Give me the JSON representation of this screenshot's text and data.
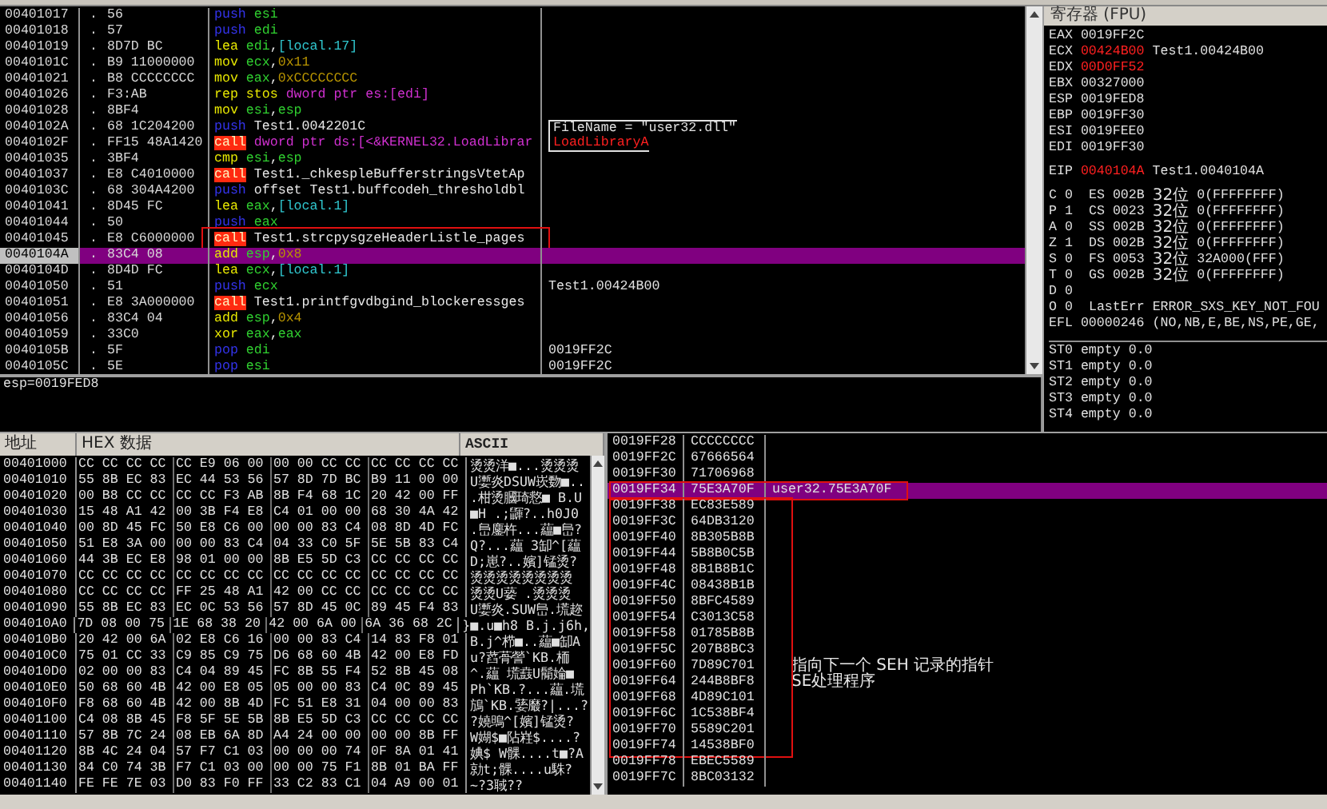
{
  "disassembly": {
    "rows": [
      {
        "address": "00401017",
        "marker": ".",
        "bytes": "56",
        "tokens": [
          {
            "text": "push",
            "kind": "stackop"
          },
          {
            "text": "esi",
            "kind": "reg"
          }
        ],
        "selected": false,
        "boxed": false
      },
      {
        "address": "00401018",
        "marker": ".",
        "bytes": "57",
        "tokens": [
          {
            "text": "push",
            "kind": "stackop"
          },
          {
            "text": "edi",
            "kind": "reg"
          }
        ],
        "selected": false,
        "boxed": false
      },
      {
        "address": "00401019",
        "marker": ".",
        "bytes": "8D7D BC",
        "tokens": [
          {
            "text": "lea",
            "kind": "op"
          },
          {
            "text": "edi",
            "kind": "reg"
          },
          {
            "text": ",",
            "kind": "plain"
          },
          {
            "text": "[local.17]",
            "kind": "mem"
          }
        ],
        "selected": false,
        "boxed": false
      },
      {
        "address": "0040101C",
        "marker": ".",
        "bytes": "B9 11000000",
        "tokens": [
          {
            "text": "mov",
            "kind": "op"
          },
          {
            "text": "ecx",
            "kind": "reg"
          },
          {
            "text": ",",
            "kind": "plain"
          },
          {
            "text": "0x11",
            "kind": "const"
          }
        ],
        "selected": false,
        "boxed": false
      },
      {
        "address": "00401021",
        "marker": ".",
        "bytes": "B8 CCCCCCCC",
        "tokens": [
          {
            "text": "mov",
            "kind": "op"
          },
          {
            "text": "eax",
            "kind": "reg"
          },
          {
            "text": ",",
            "kind": "plain"
          },
          {
            "text": "0xCCCCCCCC",
            "kind": "const"
          }
        ],
        "selected": false,
        "boxed": false
      },
      {
        "address": "00401026",
        "marker": ".",
        "bytes": "F3:AB",
        "tokens": [
          {
            "text": "rep stos",
            "kind": "op"
          },
          {
            "text": "dword ptr es:[edi]",
            "kind": "ptr"
          }
        ],
        "selected": false,
        "boxed": false
      },
      {
        "address": "00401028",
        "marker": ".",
        "bytes": "8BF4",
        "tokens": [
          {
            "text": "mov",
            "kind": "op"
          },
          {
            "text": "esi",
            "kind": "reg"
          },
          {
            "text": ",",
            "kind": "plain"
          },
          {
            "text": "esp",
            "kind": "reg"
          }
        ],
        "selected": false,
        "boxed": false
      },
      {
        "address": "0040102A",
        "marker": ".",
        "bytes": "68 1C204200",
        "tokens": [
          {
            "text": "push",
            "kind": "stackop"
          },
          {
            "text": "Test1.0042201C",
            "kind": "sym"
          }
        ],
        "comment": {
          "text": "FileName = \"user32.dll\"",
          "kind": "arg"
        },
        "selected": false,
        "boxed": false
      },
      {
        "address": "0040102F",
        "marker": ".",
        "bytes": "FF15 48A1420",
        "tokens": [
          {
            "text": "call",
            "kind": "callop"
          },
          {
            "text": "dword ptr ds:[<&KERNEL32.LoadLibrar",
            "kind": "ptr"
          }
        ],
        "comment": {
          "text": "LoadLibraryA",
          "kind": "api"
        },
        "selected": false,
        "boxed": false
      },
      {
        "address": "00401035",
        "marker": ".",
        "bytes": "3BF4",
        "tokens": [
          {
            "text": "cmp",
            "kind": "op"
          },
          {
            "text": "esi",
            "kind": "reg"
          },
          {
            "text": ",",
            "kind": "plain"
          },
          {
            "text": "esp",
            "kind": "reg"
          }
        ],
        "selected": false,
        "boxed": false
      },
      {
        "address": "00401037",
        "marker": ".",
        "bytes": "E8 C4010000",
        "tokens": [
          {
            "text": "call",
            "kind": "callop"
          },
          {
            "text": "Test1._chkespleBufferstringsVtetAp",
            "kind": "sym"
          }
        ],
        "selected": false,
        "boxed": false
      },
      {
        "address": "0040103C",
        "marker": ".",
        "bytes": "68 304A4200",
        "tokens": [
          {
            "text": "push",
            "kind": "stackop"
          },
          {
            "text": "offset Test1.buffcodeh_thresholdbl",
            "kind": "sym"
          }
        ],
        "selected": false,
        "boxed": false
      },
      {
        "address": "00401041",
        "marker": ".",
        "bytes": "8D45 FC",
        "tokens": [
          {
            "text": "lea",
            "kind": "op"
          },
          {
            "text": "eax",
            "kind": "reg"
          },
          {
            "text": ",",
            "kind": "plain"
          },
          {
            "text": "[local.1]",
            "kind": "mem"
          }
        ],
        "selected": false,
        "boxed": false
      },
      {
        "address": "00401044",
        "marker": ".",
        "bytes": "50",
        "tokens": [
          {
            "text": "push",
            "kind": "stackop"
          },
          {
            "text": "eax",
            "kind": "reg"
          }
        ],
        "selected": false,
        "boxed": false
      },
      {
        "address": "00401045",
        "marker": ".",
        "bytes": "E8 C6000000",
        "tokens": [
          {
            "text": "call",
            "kind": "callop"
          },
          {
            "text": "Test1.strcpysgzeHeaderListle_pages",
            "kind": "sym"
          }
        ],
        "selected": false,
        "boxed": true
      },
      {
        "address": "0040104A",
        "marker": ".",
        "bytes": "83C4 08",
        "tokens": [
          {
            "text": "add",
            "kind": "op"
          },
          {
            "text": "esp",
            "kind": "reg"
          },
          {
            "text": ",",
            "kind": "plain"
          },
          {
            "text": "0x8",
            "kind": "const"
          }
        ],
        "selected": true,
        "boxed": false
      },
      {
        "address": "0040104D",
        "marker": ".",
        "bytes": "8D4D FC",
        "tokens": [
          {
            "text": "lea",
            "kind": "op"
          },
          {
            "text": "ecx",
            "kind": "reg"
          },
          {
            "text": ",",
            "kind": "plain"
          },
          {
            "text": "[local.1]",
            "kind": "mem"
          }
        ],
        "selected": false,
        "boxed": false
      },
      {
        "address": "00401050",
        "marker": ".",
        "bytes": "51",
        "tokens": [
          {
            "text": "push",
            "kind": "stackop"
          },
          {
            "text": "ecx",
            "kind": "reg"
          }
        ],
        "comment": {
          "text": "Test1.00424B00",
          "kind": "plain"
        },
        "selected": false,
        "boxed": false
      },
      {
        "address": "00401051",
        "marker": ".",
        "bytes": "E8 3A000000",
        "tokens": [
          {
            "text": "call",
            "kind": "callop"
          },
          {
            "text": "Test1.printfgvdbgind_blockeressges",
            "kind": "sym"
          }
        ],
        "selected": false,
        "boxed": false
      },
      {
        "address": "00401056",
        "marker": ".",
        "bytes": "83C4 04",
        "tokens": [
          {
            "text": "add",
            "kind": "op"
          },
          {
            "text": "esp",
            "kind": "reg"
          },
          {
            "text": ",",
            "kind": "plain"
          },
          {
            "text": "0x4",
            "kind": "const"
          }
        ],
        "selected": false,
        "boxed": false
      },
      {
        "address": "00401059",
        "marker": ".",
        "bytes": "33C0",
        "tokens": [
          {
            "text": "xor",
            "kind": "op"
          },
          {
            "text": "eax",
            "kind": "reg"
          },
          {
            "text": ",",
            "kind": "plain"
          },
          {
            "text": "eax",
            "kind": "reg"
          }
        ],
        "selected": false,
        "boxed": false
      },
      {
        "address": "0040105B",
        "marker": ".",
        "bytes": "5F",
        "tokens": [
          {
            "text": "pop",
            "kind": "stackop"
          },
          {
            "text": "edi",
            "kind": "reg"
          }
        ],
        "comment": {
          "text": "0019FF2C",
          "kind": "plain"
        },
        "selected": false,
        "boxed": false
      },
      {
        "address": "0040105C",
        "marker": ".",
        "bytes": "5E",
        "tokens": [
          {
            "text": "pop",
            "kind": "stackop"
          },
          {
            "text": "esi",
            "kind": "reg"
          }
        ],
        "comment": {
          "text": "0019FF2C",
          "kind": "plain"
        },
        "selected": false,
        "boxed": false
      }
    ]
  },
  "info_line": "esp=0019FED8",
  "registers": {
    "title": "寄存器 (FPU)",
    "general": [
      {
        "name": "EAX",
        "value": "0019FF2C",
        "changed": false
      },
      {
        "name": "ECX",
        "value": "00424B00",
        "changed": true,
        "comment": "Test1.00424B00"
      },
      {
        "name": "EDX",
        "value": "00D0FF52",
        "changed": true
      },
      {
        "name": "EBX",
        "value": "00327000",
        "changed": false
      },
      {
        "name": "ESP",
        "value": "0019FED8",
        "changed": false
      },
      {
        "name": "EBP",
        "value": "0019FF30",
        "changed": false
      },
      {
        "name": "ESI",
        "value": "0019FEE0",
        "changed": false
      },
      {
        "name": "EDI",
        "value": "0019FF30",
        "changed": false
      }
    ],
    "eip": {
      "name": "EIP",
      "value": "0040104A",
      "changed": true,
      "comment": "Test1.0040104A"
    },
    "flags": [
      {
        "flag": "C",
        "value": "0",
        "segment": "ES",
        "selector": "002B",
        "bits": "32位",
        "limit": "0(FFFFFFFF)"
      },
      {
        "flag": "P",
        "value": "1",
        "segment": "CS",
        "selector": "0023",
        "bits": "32位",
        "limit": "0(FFFFFFFF)"
      },
      {
        "flag": "A",
        "value": "0",
        "segment": "SS",
        "selector": "002B",
        "bits": "32位",
        "limit": "0(FFFFFFFF)"
      },
      {
        "flag": "Z",
        "value": "1",
        "segment": "DS",
        "selector": "002B",
        "bits": "32位",
        "limit": "0(FFFFFFFF)"
      },
      {
        "flag": "S",
        "value": "0",
        "segment": "FS",
        "selector": "0053",
        "bits": "32位",
        "limit": "32A000(FFF)"
      },
      {
        "flag": "T",
        "value": "0",
        "segment": "GS",
        "selector": "002B",
        "bits": "32位",
        "limit": "0(FFFFFFFF)"
      },
      {
        "flag": "D",
        "value": "0"
      },
      {
        "flag": "O",
        "value": "0",
        "last_error_label": "LastErr",
        "last_error": "ERROR_SXS_KEY_NOT_FOU"
      }
    ],
    "efl": {
      "name": "EFL",
      "value": "00000246",
      "comment": "(NO,NB,E,BE,NS,PE,GE,"
    },
    "fpu": [
      {
        "name": "ST0",
        "tag": "empty",
        "value": "0.0"
      },
      {
        "name": "ST1",
        "tag": "empty",
        "value": "0.0"
      },
      {
        "name": "ST2",
        "tag": "empty",
        "value": "0.0"
      },
      {
        "name": "ST3",
        "tag": "empty",
        "value": "0.0"
      },
      {
        "name": "ST4",
        "tag": "empty",
        "value": "0.0"
      }
    ]
  },
  "dump": {
    "headers": [
      "地址",
      "HEX 数据",
      "ASCII"
    ],
    "rows": [
      {
        "address": "00401000",
        "hex": [
          "CC CC CC CC",
          "CC E9 06 00",
          "00 00 CC CC",
          "CC CC CC CC"
        ],
        "ascii": "烫烫洋■...烫烫烫"
      },
      {
        "address": "00401010",
        "hex": [
          "55 8B EC 83",
          "EC 44 53 56",
          "57 8D 7D BC",
          "B9 11 00 00"
        ],
        "ascii": "U嬱炎DSUW崁覅■.."
      },
      {
        "address": "00401020",
        "hex": [
          "00 B8 CC CC",
          "CC CC F3 AB",
          "8B F4 68 1C",
          "20 42 00 FF"
        ],
        "ascii": ".柑烫膕琦慦■ B.U"
      },
      {
        "address": "00401030",
        "hex": [
          "15 48 A1 42",
          "00 3B F4 E8",
          "C4 01 00 00",
          "68 30 4A 42"
        ],
        "ascii": "■H .;鼲?..h0J0"
      },
      {
        "address": "00401040",
        "hex": [
          "00 8D 45 FC",
          "50 E8 C6 00",
          "00 00 83 C4",
          "08 8D 4D FC"
        ],
        "ascii": ".峊鏖杵...藴■峊?"
      },
      {
        "address": "00401050",
        "hex": [
          "51 E8 3A 00",
          "00 00 83 C4",
          "04 33 C0 5F",
          "5E 5B 83 C4"
        ],
        "ascii": "Q?...藴 3缷^[藴"
      },
      {
        "address": "00401060",
        "hex": [
          "44 3B EC E8",
          "98 01 00 00",
          "8B E5 5D C3",
          "CC CC CC CC"
        ],
        "ascii": "D;崽?..嬪]锰烫?"
      },
      {
        "address": "00401070",
        "hex": [
          "CC CC CC CC",
          "CC CC CC CC",
          "CC CC CC CC",
          "CC CC CC CC"
        ],
        "ascii": "烫烫烫烫烫烫烫烫"
      },
      {
        "address": "00401080",
        "hex": [
          "CC CC CC CC",
          "FF 25 48 A1",
          "42 00 CC CC",
          "CC CC CC CC"
        ],
        "ascii": "烫烫U蒆 .烫烫烫"
      },
      {
        "address": "00401090",
        "hex": [
          "55 8B EC 83",
          "EC 0C 53 56",
          "57 8D 45 0C",
          "89 45 F4 83"
        ],
        "ascii": "U嬱炎.SUW峊.塃趂"
      },
      {
        "address": "004010A0",
        "hex": [
          "7D 08 00 75",
          "1E 68 38 20",
          "42 00 6A 00",
          "6A 36 68 2C"
        ],
        "ascii": "}■.u■h8 B.j.j6h,"
      },
      {
        "address": "004010B0",
        "hex": [
          "20 42 00 6A",
          "02 E8 C6 16",
          "00 00 83 C4",
          "14 83 F8 01"
        ],
        "ascii": " B.j^栉■..藴■缷A"
      },
      {
        "address": "004010C0",
        "hex": [
          "75 01 CC 33",
          "C9 85 C9 75",
          "D6 68 60 4B",
          "42 00 E8 FD"
        ],
        "ascii": "u?蓞蓇謍`KB.栭"
      },
      {
        "address": "004010D0",
        "hex": [
          "02 00 00 83",
          "C4 04 89 45",
          "FC 8B 55 F4",
          "52 8B 45 08"
        ],
        "ascii": "^.藴 塃鼖U鬜婨■"
      },
      {
        "address": "004010E0",
        "hex": [
          "50 68 60 4B",
          "42 00 E8 05",
          "05 00 00 83",
          "C4 0C 89 45"
        ],
        "ascii": "Ph`KB.?...藴.塃"
      },
      {
        "address": "004010F0",
        "hex": [
          "F8 68 60 4B",
          "42 00 8B 4D",
          "FC 51 E8 31",
          "04 00 00 83"
        ],
        "ascii": "鴋`KB.婱黀?|...?"
      },
      {
        "address": "00401100",
        "hex": [
          "C4 08 8B 45",
          "F8 5F 5E 5B",
          "8B E5 5D C3",
          "CC CC CC CC"
        ],
        "ascii": "?嬈鴠^[嬪]锰烫?"
      },
      {
        "address": "00401110",
        "hex": [
          "57 8B 7C 24",
          "08 EB 6A 8D",
          "A4 24 00 00",
          "00 00 8B FF"
        ],
        "ascii": "W媩$■阽嵀$....?"
      },
      {
        "address": "00401120",
        "hex": [
          "8B 4C 24 04",
          "57 F7 C1 03",
          "00 00 00 74",
          "0F 8A 01 41"
        ],
        "ascii": "婰$ W髁....t■?A"
      },
      {
        "address": "00401130",
        "hex": [
          "84 C0 74 3B",
          "F7 C1 03 00",
          "00 00 75 F1",
          "8B 01 BA FF"
        ],
        "ascii": "勍t;髁....u駯?"
      },
      {
        "address": "00401140",
        "hex": [
          "FE FE 7E 03",
          "D0 83 F0 FF",
          "33 C2 83 C1",
          "04 A9 00 01"
        ],
        "ascii": "~?3聝??"
      }
    ]
  },
  "stack": {
    "groups": [
      {
        "boxed": false,
        "rows": [
          {
            "address": "0019FF28",
            "value": "CCCCCCCC",
            "selected": false,
            "outlined": false
          },
          {
            "address": "0019FF2C",
            "value": "67666564",
            "selected": false,
            "outlined": false
          },
          {
            "address": "0019FF30",
            "value": "71706968",
            "selected": false,
            "outlined": false
          },
          {
            "address": "0019FF34",
            "value": "75E3A70F",
            "comment": {
              "text": "user32.75E3A70F",
              "kind": "plain"
            },
            "selected": true,
            "outlined": true
          }
        ]
      },
      {
        "boxed": true,
        "rows": [
          {
            "address": "0019FF38",
            "value": "EC83E589",
            "selected": false,
            "outlined": false
          },
          {
            "address": "0019FF3C",
            "value": "64DB3120",
            "selected": false,
            "outlined": false
          },
          {
            "address": "0019FF40",
            "value": "8B305B8B",
            "selected": false,
            "outlined": false
          },
          {
            "address": "0019FF44",
            "value": "5B8B0C5B",
            "selected": false,
            "outlined": false
          },
          {
            "address": "0019FF48",
            "value": "8B1B8B1C",
            "selected": false,
            "outlined": false
          },
          {
            "address": "0019FF4C",
            "value": "08438B1B",
            "selected": false,
            "outlined": false
          },
          {
            "address": "0019FF50",
            "value": "8BFC4589",
            "selected": false,
            "outlined": false
          },
          {
            "address": "0019FF54",
            "value": "C3013C58",
            "selected": false,
            "outlined": false
          },
          {
            "address": "0019FF58",
            "value": "01785B8B",
            "selected": false,
            "outlined": false
          },
          {
            "address": "0019FF5C",
            "value": "207B8BC3",
            "selected": false,
            "outlined": false
          },
          {
            "address": "0019FF60",
            "value": "7D89C701",
            "comment": {
              "text": "指向下一个 SEH 记录的指针",
              "kind": "note"
            },
            "selected": false,
            "outlined": false
          },
          {
            "address": "0019FF64",
            "value": "244B8BF8",
            "comment": {
              "text": "SE处理程序",
              "kind": "note"
            },
            "selected": false,
            "outlined": false
          },
          {
            "address": "0019FF68",
            "value": "4D89C101",
            "selected": false,
            "outlined": false
          },
          {
            "address": "0019FF6C",
            "value": "1C538BF4",
            "selected": false,
            "outlined": false
          },
          {
            "address": "0019FF70",
            "value": "5589C201",
            "selected": false,
            "outlined": false
          },
          {
            "address": "0019FF74",
            "value": "14538BF0",
            "selected": false,
            "outlined": false
          }
        ]
      },
      {
        "boxed": false,
        "rows": [
          {
            "address": "0019FF78",
            "value": "EBEC5589",
            "selected": false,
            "outlined": false
          },
          {
            "address": "0019FF7C",
            "value": "8BC03132",
            "selected": false,
            "outlined": false
          }
        ]
      }
    ]
  }
}
